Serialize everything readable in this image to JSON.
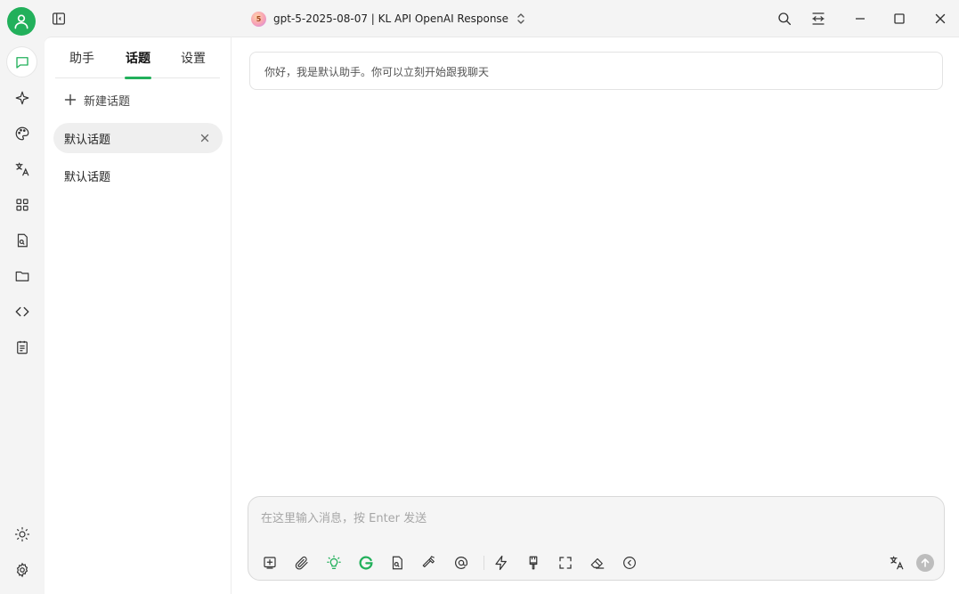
{
  "window": {
    "model_logo_text": "5",
    "model_name": "gpt-5-2025-08-07 | KL API OpenAI Response"
  },
  "rail": {
    "items": [
      "chat-icon",
      "sparkle-icon",
      "palette-icon",
      "translate-icon",
      "apps-grid-icon",
      "document-search-icon",
      "folder-icon",
      "code-icon",
      "notes-icon"
    ],
    "bottom": [
      "sun-icon",
      "gear-icon"
    ]
  },
  "tabs": {
    "assistant": "助手",
    "topics": "话题",
    "settings": "设置"
  },
  "topics": {
    "new_topic_label": "新建话题",
    "items": [
      {
        "label": "默认话题",
        "active": true
      },
      {
        "label": "默认话题",
        "active": false
      }
    ]
  },
  "chat": {
    "greeting": "你好，我是默认助手。你可以立刻开始跟我聊天",
    "input_placeholder": "在这里输入消息，按 Enter 发送",
    "input_value": ""
  },
  "colors": {
    "accent": "#22b05b",
    "background": "#f4f4f4",
    "panel": "#ffffff"
  }
}
